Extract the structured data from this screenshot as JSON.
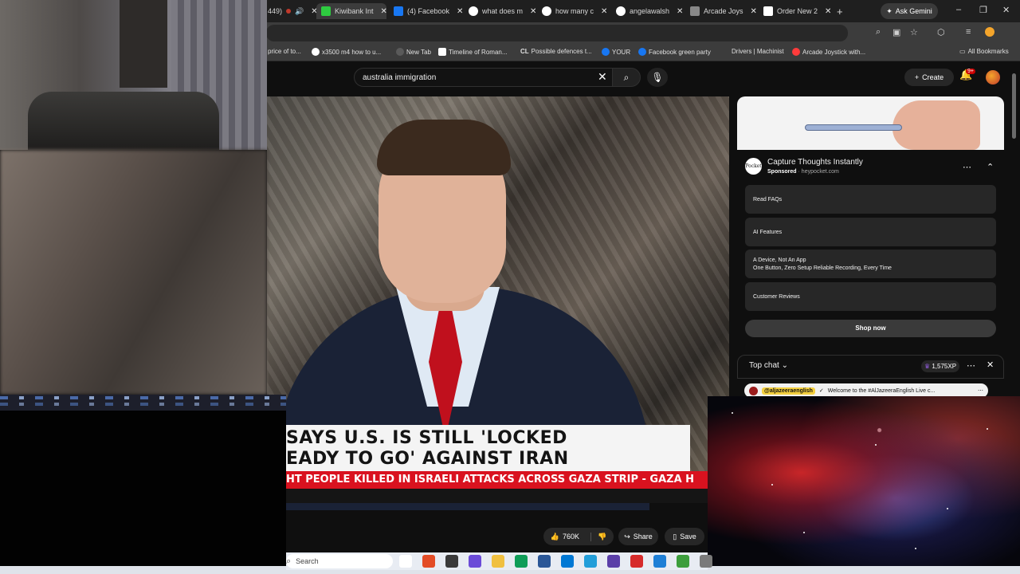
{
  "browser": {
    "tabs": [
      {
        "label": "449)",
        "favicon_color": "#c0392b"
      },
      {
        "label": "Kiwibank Int",
        "favicon_color": "#2ecc40"
      },
      {
        "label": "(4) Facebook",
        "favicon_color": "#1877f2"
      },
      {
        "label": "what does m",
        "favicon_color": "#ffffff"
      },
      {
        "label": "how many c",
        "favicon_color": "#ffffff"
      },
      {
        "label": "angelawalsh",
        "favicon_color": "#ffffff"
      },
      {
        "label": "Arcade Joys",
        "favicon_color": "#888888"
      },
      {
        "label": "Order New 2",
        "favicon_color": "#ffffff"
      }
    ],
    "new_tab_label": "+",
    "ask_gemini_label": "Ask Gemini",
    "window_controls": [
      "–",
      "❐",
      "✕"
    ],
    "bookmarks": [
      {
        "label": "price of to...",
        "favicon_color": "#3c3c3c"
      },
      {
        "label": "x3500 m4 how to u...",
        "favicon_color": "#ffffff"
      },
      {
        "label": "New Tab",
        "favicon_color": "#3c3c3c"
      },
      {
        "label": "Timeline of Roman...",
        "favicon_color": "#ffffff"
      },
      {
        "label": "Possible defences t...",
        "favicon_color": "#3c3c3c"
      },
      {
        "label": "YOUR",
        "favicon_color": "#1877f2"
      },
      {
        "label": "Facebook green party",
        "favicon_color": "#1877f2"
      },
      {
        "label": "Drivers | Machinist",
        "favicon_color": "#3c3c3c"
      },
      {
        "label": "Arcade Joystick with...",
        "favicon_color": "#ff3b3b"
      }
    ],
    "all_bookmarks_label": "All Bookmarks"
  },
  "youtube": {
    "search_value": "australia immigration",
    "create_label": "Create",
    "notification_badge": "9+",
    "video": {
      "ticker_line1": "SAYS U.S. IS STILL 'LOCKED",
      "ticker_line2": "EADY TO GO' AGAINST IRAN",
      "ticker_crawl": "HT PEOPLE KILLED IN ISRAELI ATTACKS ACROSS GAZA STRIP   -   GAZA H"
    },
    "actions": {
      "like_count": "760K",
      "share_label": "Share",
      "save_label": "Save"
    },
    "ad": {
      "title": "Capture Thoughts Instantly",
      "sponsored_label": "Sponsored",
      "domain": "heypocket.com",
      "logo_text": "Pocket",
      "rows": [
        {
          "label": "Read FAQs",
          "sub": ""
        },
        {
          "label": "AI Features",
          "sub": ""
        },
        {
          "label": "A Device, Not An App",
          "sub": "One Button, Zero Setup Reliable Recording, Every Time"
        },
        {
          "label": "Customer Reviews",
          "sub": ""
        }
      ],
      "cta_label": "Shop now"
    },
    "chat": {
      "title": "Top chat",
      "xp_badge": "1,575XP",
      "pinned_handle": "@aljazeeraenglish",
      "pinned_message": "Welcome to the #AlJazeeraEnglish Live c..."
    }
  },
  "taskbar": {
    "search_placeholder": "Search",
    "apps": [
      "#ffffff",
      "#e34c26",
      "#3a3a3a",
      "#6b4bd8",
      "#f0c040",
      "#0f9d58",
      "#2b5797",
      "#0078d4",
      "#229ed9",
      "#5b3fa8",
      "#d62b2b",
      "#1e7fd6",
      "#3c9e3c",
      "#7a7a7a"
    ]
  },
  "colors": {
    "youtube_dark": "#0f0f0f",
    "ticker_red": "#d9121f",
    "accent_pill": "#272727"
  }
}
